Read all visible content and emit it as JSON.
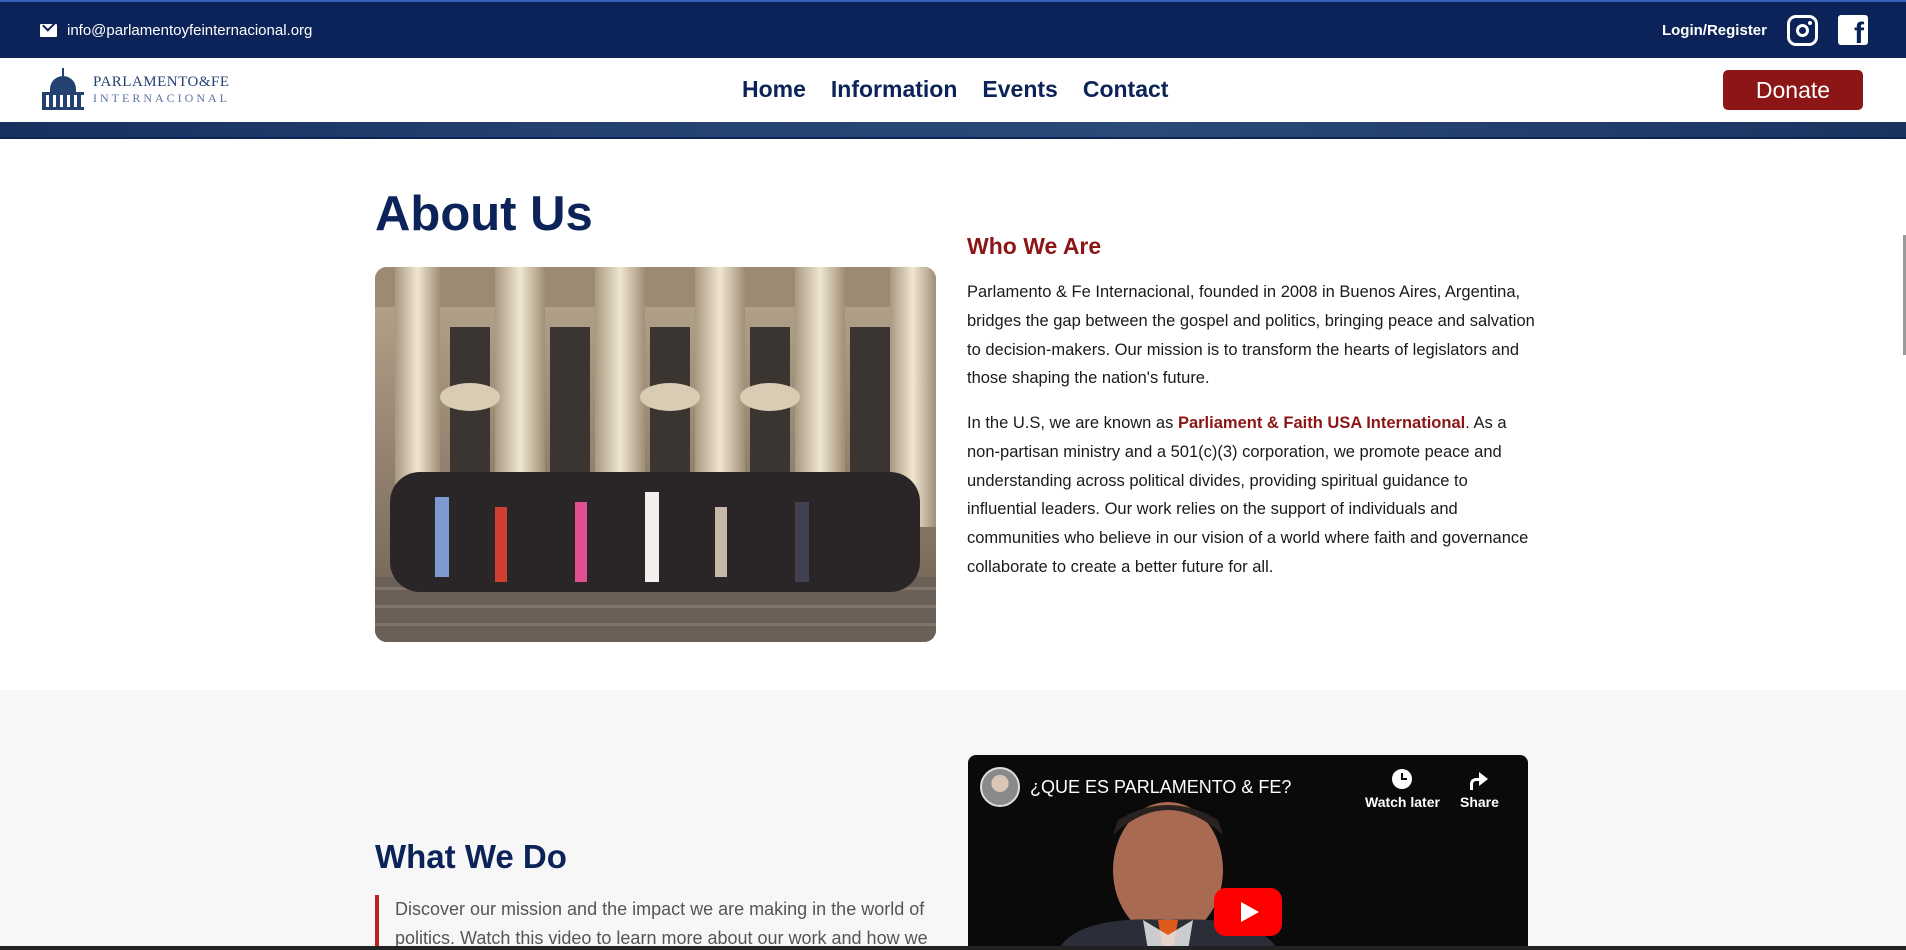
{
  "topbar": {
    "email": "info@parlamentoyfeinternacional.org",
    "login": "Login/Register",
    "social": [
      "instagram-icon",
      "facebook-icon"
    ]
  },
  "logo": {
    "line1": "PARLAMENTO&FE",
    "line2": "INTERNACIONAL"
  },
  "nav": {
    "items": [
      {
        "label": "Home"
      },
      {
        "label": "Information"
      },
      {
        "label": "Events"
      },
      {
        "label": "Contact"
      }
    ],
    "donate": "Donate"
  },
  "about": {
    "title": "About Us",
    "who_title": "Who We Are",
    "p1": "Parlamento & Fe Internacional, founded in 2008 in Buenos Aires, Argentina, bridges the gap between the gospel and politics, bringing peace and salvation to decision-makers. Our mission is to transform the hearts of legislators and those shaping the nation's future.",
    "p2_before": "In the U.S, we are known as ",
    "p2_highlight": "Parliament & Faith USA International",
    "p2_after": ". As a non-partisan ministry and a 501(c)(3) corporation, we promote peace and understanding across political divides, providing spiritual guidance to influential leaders. Our work relies on the support of individuals and communities who believe in our vision of a world where faith and governance collaborate to create a better future for all."
  },
  "what": {
    "title": "What We Do",
    "text": "Discover our mission and the impact we are making in the world of politics. Watch this video to learn more about our work and how we"
  },
  "video": {
    "title": "¿QUE ES PARLAMENTO & FE?",
    "watch_later": "Watch later",
    "share": "Share"
  },
  "colors": {
    "navy": "#0b2358",
    "accent_red": "#8c1515",
    "youtube_red": "#ff0000"
  }
}
